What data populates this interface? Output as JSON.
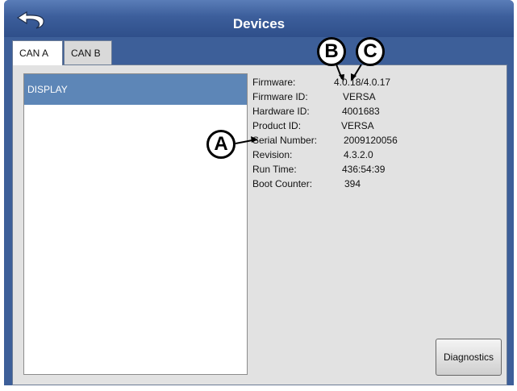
{
  "header": {
    "title": "Devices",
    "back_icon": "back-arrow-icon"
  },
  "tabs": [
    {
      "label": "CAN A",
      "active": true
    },
    {
      "label": "CAN B",
      "active": false
    }
  ],
  "device_list": {
    "items": [
      "DISPLAY"
    ],
    "selected": "DISPLAY"
  },
  "details": {
    "firmware": {
      "label": "Firmware:",
      "value": "4.0.18/4.0.17"
    },
    "firmware_id": {
      "label": "Firmware ID:",
      "value": "VERSA"
    },
    "hardware_id": {
      "label": "Hardware ID:",
      "value": "4001683"
    },
    "product_id": {
      "label": "Product ID:",
      "value": "VERSA"
    },
    "serial_number": {
      "label": "Serial Number:",
      "value": "2009120056"
    },
    "revision": {
      "label": "Revision:",
      "value": "4.3.2.0"
    },
    "run_time": {
      "label": "Run Time:",
      "value": "436:54:39"
    },
    "boot_counter": {
      "label": "Boot Counter:",
      "value": "394"
    }
  },
  "buttons": {
    "diagnostics": "Diagnostics"
  },
  "callouts": {
    "a": "A",
    "b": "B",
    "c": "C"
  },
  "colors": {
    "title_bar": "#3c5e9b",
    "selected_item": "#5d86b7",
    "panel_bg": "#e2e2e2"
  }
}
